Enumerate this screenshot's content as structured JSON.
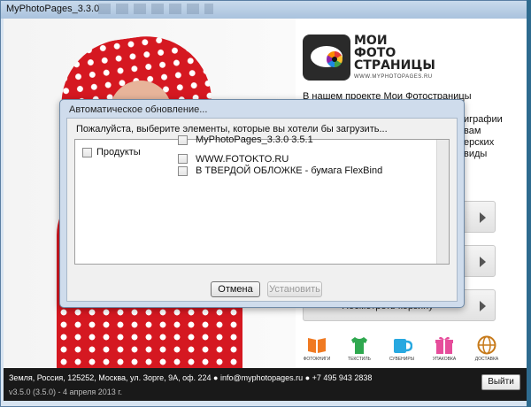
{
  "app": {
    "title": "MyPhotoPages_3.3.0"
  },
  "logo": {
    "line1": "МОИ",
    "line2": "ФОТО",
    "line3": "СТРАНИЦЫ",
    "url": "WWW.MYPHOTOPAGES.RU"
  },
  "intro": {
    "text": "В нашем проекте Мои Фотостраницы",
    "snips": [
      "играфии",
      "вам",
      "ерских",
      "виды"
    ]
  },
  "side_buttons": [
    {
      "label": ""
    },
    {
      "label": ""
    },
    {
      "label": "Посмотреть корзину"
    }
  ],
  "categories": [
    {
      "label": "ФОТОКНИГИ",
      "icon": "book-icon",
      "color": "#f07a22"
    },
    {
      "label": "ТЕКСТИЛЬ",
      "icon": "tshirt-icon",
      "color": "#2fa84f"
    },
    {
      "label": "СУВЕНИРЫ",
      "icon": "mug-icon",
      "color": "#28a8e0"
    },
    {
      "label": "УПАКОВКА",
      "icon": "gift-icon",
      "color": "#e64d9b"
    },
    {
      "label": "ДОСТАВКА",
      "icon": "globe-icon",
      "color": "#c77a1a"
    }
  ],
  "footer": {
    "address": "Земля, Россия, 125252, Москва, ул. Зорге, 9А, оф. 224 ● info@myphotopages.ru  ● +7 495 943 2838",
    "version": "v3.5.0 (3.5.0) - 4 апреля 2013 г.",
    "exit_label": "Выйти"
  },
  "dialog": {
    "title": "Автоматическое обновление...",
    "prompt": "Пожалуйста, выберите элементы, которые вы хотели бы загрузить...",
    "group_label": "Продукты",
    "items": [
      {
        "label": "MyPhotoPages_3.3.0 3.5.1",
        "checked": false
      },
      {
        "label": "WWW.FOTOKTO.RU",
        "checked": false
      },
      {
        "label": "В ТВЕРДОЙ ОБЛОЖКЕ - бумага FlexBind",
        "checked": false
      }
    ],
    "cancel_label": "Отмена",
    "install_label": "Установить"
  },
  "colors": {
    "accent_red": "#d51821",
    "footer_bg": "#191919",
    "dialog_frame": "#cfdcec"
  }
}
